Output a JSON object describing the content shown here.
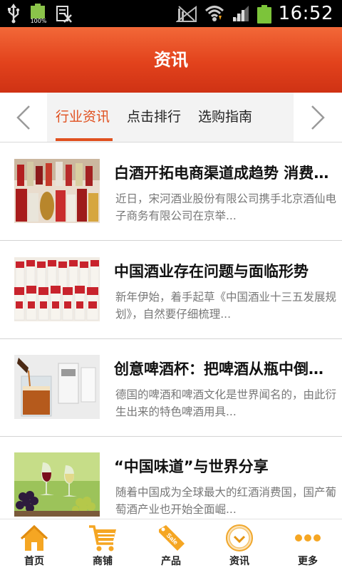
{
  "status_bar": {
    "battery_small_pct": "100%",
    "time": "16:52"
  },
  "header": {
    "title": "资讯"
  },
  "tabs": [
    {
      "label": "行业资讯",
      "active": true
    },
    {
      "label": "点击排行",
      "active": false
    },
    {
      "label": "选购指南",
      "active": false
    }
  ],
  "news": [
    {
      "title": "白酒开拓电商渠道成趋势 消费者在哪里渠道就到哪里",
      "desc": "近日，宋河酒业股份有限公司携手北京酒仙电子商务有限公司在京举..."
    },
    {
      "title": "中国酒业存在问题与面临形势",
      "desc": "新年伊始，着手起草《中国酒业十三五发展规划》，自然要仔细梳理..."
    },
    {
      "title": "创意啤酒杯：把啤酒从瓶中倒入杯中",
      "desc": "德国的啤酒和啤酒文化是世界闻名的，由此衍生出来的特色啤酒用具..."
    },
    {
      "title": "“中国味道”与世界分享",
      "desc": "随着中国成为全球最大的红酒消费国，国产葡萄酒产业也开始全面崛..."
    }
  ],
  "bottom_nav": [
    {
      "label": "首页",
      "icon": "home-icon"
    },
    {
      "label": "商铺",
      "icon": "cart-icon"
    },
    {
      "label": "产品",
      "icon": "sale-tag-icon",
      "tag_text": "Sale"
    },
    {
      "label": "资讯",
      "icon": "clock-icon"
    },
    {
      "label": "更多",
      "icon": "more-dots-icon"
    }
  ],
  "colors": {
    "header_accent": "#e2421c",
    "active_tab": "#e0501f",
    "icon_orange": "#f5a623"
  }
}
